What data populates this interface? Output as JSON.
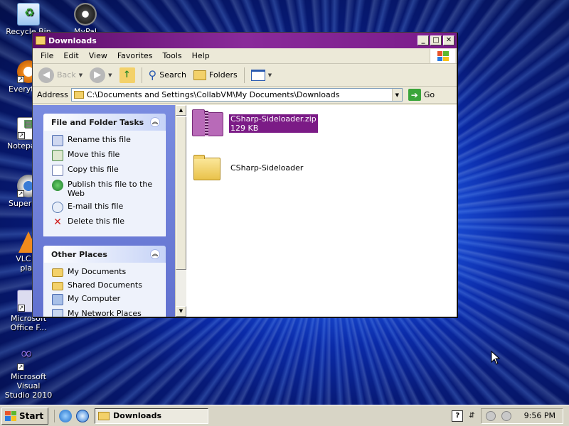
{
  "desktop": {
    "icons": [
      {
        "label": "Recycle Bin",
        "icon": "recycle-bin-icon"
      },
      {
        "label": "MyPal",
        "icon": "mypal-browser-icon"
      },
      {
        "label": "Everyt",
        "icon": "everything-search-icon"
      },
      {
        "label": "Notepa",
        "icon": "notepad-icon"
      },
      {
        "label": "Superm",
        "icon": "supermium-icon"
      },
      {
        "label": "VLC m\nplay",
        "icon": "vlc-icon"
      },
      {
        "label": "Microsoft\nOffice F...",
        "icon": "office-icon"
      },
      {
        "label": "Microsoft Visual\nStudio 2010",
        "icon": "visual-studio-icon"
      }
    ]
  },
  "window": {
    "title": "Downloads",
    "menu": [
      "File",
      "Edit",
      "View",
      "Favorites",
      "Tools",
      "Help"
    ],
    "toolbar": {
      "back": "Back",
      "search": "Search",
      "folders": "Folders"
    },
    "address": {
      "label": "Address",
      "value": "C:\\Documents and Settings\\CollabVM\\My Documents\\Downloads",
      "go": "Go"
    },
    "tasks_panel": {
      "title": "File and Folder Tasks",
      "items": [
        {
          "label": "Rename this file",
          "icon": "rename-icon"
        },
        {
          "label": "Move this file",
          "icon": "move-icon"
        },
        {
          "label": "Copy this file",
          "icon": "copy-icon"
        },
        {
          "label": "Publish this file to the Web",
          "icon": "publish-web-icon"
        },
        {
          "label": "E-mail this file",
          "icon": "email-icon"
        },
        {
          "label": "Delete this file",
          "icon": "delete-icon"
        }
      ]
    },
    "places_panel": {
      "title": "Other Places",
      "items": [
        {
          "label": "My Documents",
          "icon": "folder-icon"
        },
        {
          "label": "Shared Documents",
          "icon": "folder-icon"
        },
        {
          "label": "My Computer",
          "icon": "computer-icon"
        },
        {
          "label": "My Network Places",
          "icon": "network-icon"
        }
      ]
    },
    "files": [
      {
        "name": "CSharp-Sideloader.zip",
        "detail": "129 KB",
        "icon": "zip-folder-icon",
        "selected": true
      },
      {
        "name": "CSharp-Sideloader",
        "detail": "",
        "icon": "folder-icon",
        "selected": false
      }
    ]
  },
  "taskbar": {
    "start": "Start",
    "task": "Downloads",
    "clock": "9:56 PM"
  },
  "colors": {
    "titlebar": "#7a1b8a",
    "selection": "#7b1b86",
    "taskpane": "#6f7fd6"
  }
}
